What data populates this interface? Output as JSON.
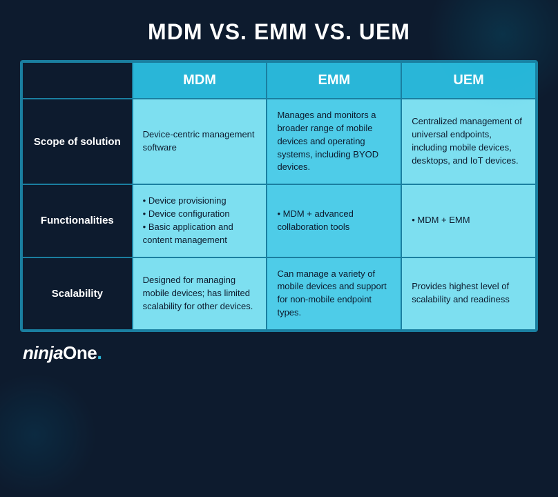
{
  "page": {
    "title": "MDM VS. EMM VS. UEM",
    "background_color": "#0d1b2e"
  },
  "table": {
    "headers": {
      "empty": "",
      "col1": "MDM",
      "col2": "EMM",
      "col3": "UEM"
    },
    "rows": [
      {
        "label": "Scope of solution",
        "col1": "Device-centric management software",
        "col2": "Manages and monitors a broader range of mobile devices and operating systems, including BYOD devices.",
        "col3": "Centralized management of universal endpoints, including mobile devices, desktops, and IoT devices."
      },
      {
        "label": "Functionalities",
        "col1": "• Device provisioning\n• Device configuration\n• Basic application and content management",
        "col2": "• MDM + advanced collaboration tools",
        "col3": "• MDM + EMM"
      },
      {
        "label": "Scalability",
        "col1": "Designed for managing mobile devices; has limited scalability for other devices.",
        "col2": "Can manage a variety of mobile devices and support for non-mobile endpoint types.",
        "col3": "Provides highest level of scalability and readiness"
      }
    ]
  },
  "logo": {
    "ninja": "ninja",
    "one": "One",
    "dot": "."
  }
}
